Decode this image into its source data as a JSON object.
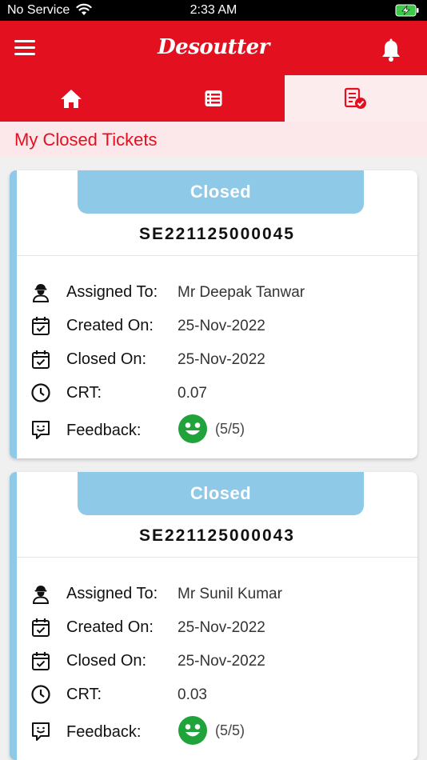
{
  "status_bar": {
    "carrier": "No Service",
    "time": "2:33 AM"
  },
  "header": {
    "brand": "Desoutter"
  },
  "tabs": [
    {
      "name": "home",
      "icon": "home-icon"
    },
    {
      "name": "ticket-list",
      "icon": "list-icon"
    },
    {
      "name": "closed-tickets",
      "icon": "closed-ticket-icon",
      "active": true
    }
  ],
  "page": {
    "title": "My Closed Tickets"
  },
  "labels": {
    "assigned_to": "Assigned To:",
    "created_on": "Created On:",
    "closed_on": "Closed On:",
    "crt": "CRT:",
    "feedback": "Feedback:"
  },
  "tickets": [
    {
      "status": "Closed",
      "number": "SE221125000045",
      "assigned_to": "Mr Deepak Tanwar",
      "created_on": "25-Nov-2022",
      "closed_on": "25-Nov-2022",
      "crt": "0.07",
      "feedback": "(5/5)"
    },
    {
      "status": "Closed",
      "number": "SE221125000043",
      "assigned_to": "Mr Sunil Kumar",
      "created_on": "25-Nov-2022",
      "closed_on": "25-Nov-2022",
      "crt": "0.03",
      "feedback": "(5/5)"
    }
  ],
  "colors": {
    "brand_red": "#e3101f",
    "status_blue": "#8ec9e8",
    "feedback_green": "#1fa33a"
  }
}
